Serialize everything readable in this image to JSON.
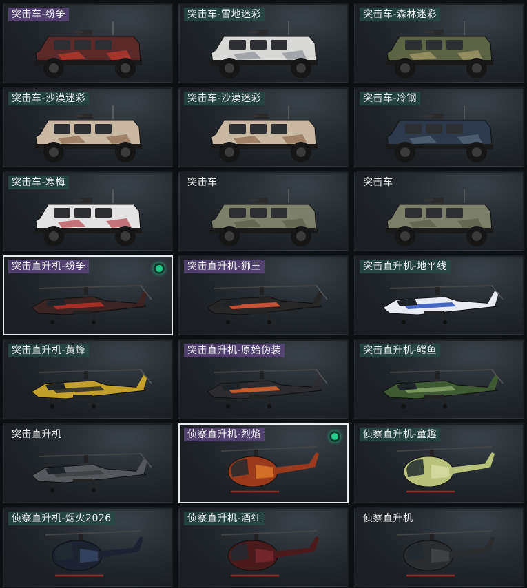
{
  "skins": [
    {
      "label": "突击车-纷争",
      "kind": "vehicle",
      "rarity": "purple",
      "body": "#5a2a2a",
      "accent": "#c23a2e",
      "equipped": false,
      "selected": false
    },
    {
      "label": "突击车-雪地迷彩",
      "kind": "vehicle",
      "rarity": "teal",
      "body": "#d8d8d6",
      "accent": "#8a8f94",
      "equipped": false,
      "selected": false
    },
    {
      "label": "突击车-森林迷彩",
      "kind": "vehicle",
      "rarity": "teal",
      "body": "#5d6445",
      "accent": "#a99e6e",
      "equipped": false,
      "selected": false
    },
    {
      "label": "突击车-沙漠迷彩",
      "kind": "vehicle",
      "rarity": "teal",
      "body": "#c9b9a2",
      "accent": "#8b6a4f",
      "equipped": false,
      "selected": false
    },
    {
      "label": "突击车-沙漠迷彩",
      "kind": "vehicle",
      "rarity": "teal",
      "body": "#c9b9a2",
      "accent": "#8b6a4f",
      "equipped": false,
      "selected": false
    },
    {
      "label": "突击车-冷钢",
      "kind": "vehicle",
      "rarity": "teal",
      "body": "#2e3a4c",
      "accent": "#5b6a80",
      "equipped": false,
      "selected": false
    },
    {
      "label": "突击车-寒梅",
      "kind": "vehicle",
      "rarity": "teal",
      "body": "#e3e3e3",
      "accent": "#b4444a",
      "equipped": false,
      "selected": false
    },
    {
      "label": "突击车",
      "kind": "vehicle",
      "rarity": "none",
      "body": "#7c7f6a",
      "accent": "#5a5d4a",
      "equipped": false,
      "selected": false
    },
    {
      "label": "突击车",
      "kind": "vehicle",
      "rarity": "none",
      "body": "#7c7f6a",
      "accent": "#5a5d4a",
      "equipped": false,
      "selected": false
    },
    {
      "label": "突击直升机-纷争",
      "kind": "heli",
      "rarity": "purple",
      "body": "#3a2424",
      "accent": "#b8302a",
      "equipped": true,
      "selected": true
    },
    {
      "label": "突击直升机-狮王",
      "kind": "heli",
      "rarity": "purple",
      "body": "#262626",
      "accent": "#e05a3a",
      "equipped": false,
      "selected": false
    },
    {
      "label": "突击直升机-地平线",
      "kind": "heli",
      "rarity": "teal",
      "body": "#e8ecf2",
      "accent": "#2a4fb8",
      "equipped": false,
      "selected": false
    },
    {
      "label": "突击直升机-黄蜂",
      "kind": "heli",
      "rarity": "teal",
      "body": "#c2a02a",
      "accent": "#2a2a2a",
      "equipped": false,
      "selected": false
    },
    {
      "label": "突击直升机-原始伪装",
      "kind": "heli",
      "rarity": "purple",
      "body": "#2c2c30",
      "accent": "#e0672e",
      "equipped": false,
      "selected": false
    },
    {
      "label": "突击直升机-鳄鱼",
      "kind": "heli",
      "rarity": "teal",
      "body": "#3e5a32",
      "accent": "#86a46a",
      "equipped": false,
      "selected": false
    },
    {
      "label": "突击直升机",
      "kind": "heli",
      "rarity": "none",
      "body": "#55585c",
      "accent": "#3c3f42",
      "equipped": false,
      "selected": false
    },
    {
      "label": "侦察直升机-烈焰",
      "kind": "scout",
      "rarity": "purple",
      "body": "#9a3a1c",
      "accent": "#e07a2a",
      "equipped": true,
      "selected": true
    },
    {
      "label": "侦察直升机-童趣",
      "kind": "scout",
      "rarity": "teal",
      "body": "#b9c27a",
      "accent": "#d8dca8",
      "equipped": false,
      "selected": false
    },
    {
      "label": "侦察直升机-烟火2026",
      "kind": "scout",
      "rarity": "teal",
      "body": "#1c2230",
      "accent": "#3a4a6a",
      "equipped": false,
      "selected": false
    },
    {
      "label": "侦察直升机-酒红",
      "kind": "scout",
      "rarity": "teal",
      "body": "#4a1a1c",
      "accent": "#7a2a2e",
      "equipped": false,
      "selected": false
    },
    {
      "label": "侦察直升机",
      "kind": "scout",
      "rarity": "none",
      "body": "#2a2c2e",
      "accent": "#45484b",
      "equipped": false,
      "selected": false
    }
  ]
}
